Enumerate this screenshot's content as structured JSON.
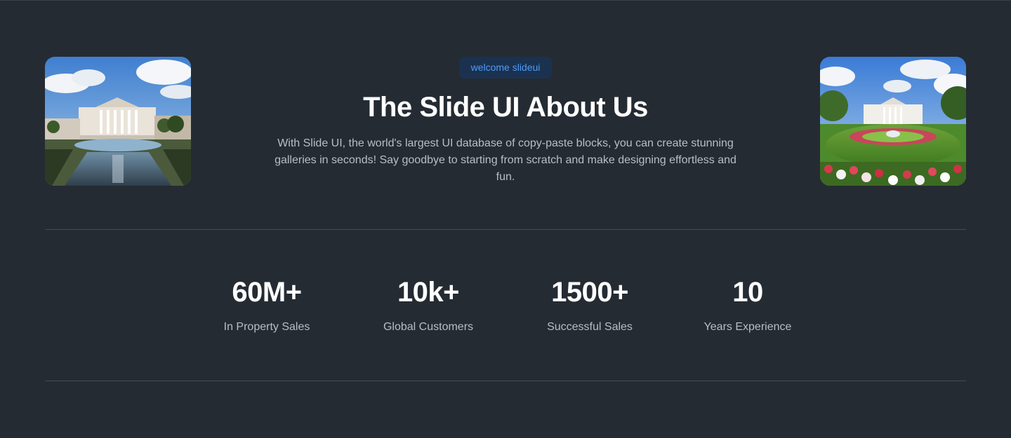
{
  "badge": {
    "label": "welcome slideui"
  },
  "hero": {
    "title": "The Slide UI About Us",
    "description": "With Slide UI, the world's largest UI database of copy-paste blocks, you can create stunning galleries in seconds! Say goodbye to starting from scratch and make designing effortless and fun."
  },
  "stats": [
    {
      "value": "60M+",
      "label": "In Property Sales"
    },
    {
      "value": "10k+",
      "label": "Global Customers"
    },
    {
      "value": "1500+",
      "label": "Successful Sales"
    },
    {
      "value": "10",
      "label": "Years Experience"
    }
  ],
  "colors": {
    "background": "#252b32",
    "badge_bg": "#1b3150",
    "badge_text": "#4e9cf5",
    "muted_text": "#b9bec6",
    "divider": "#454b53"
  }
}
